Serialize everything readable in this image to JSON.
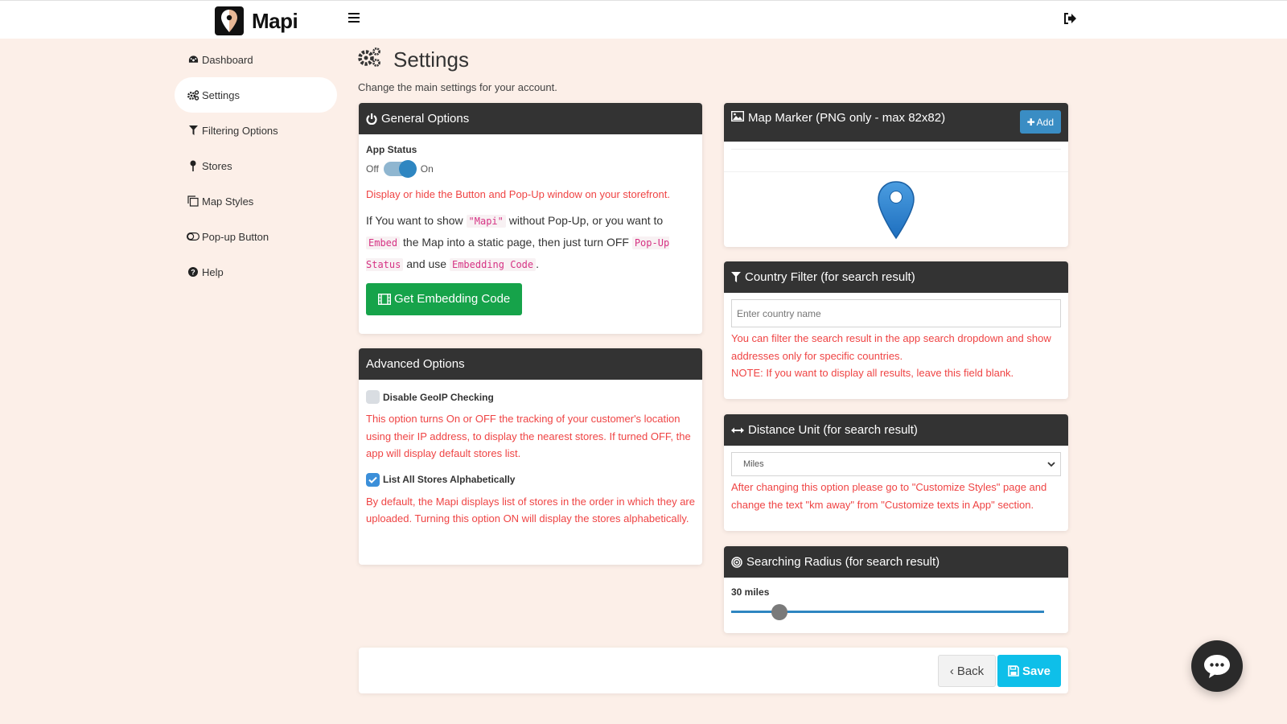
{
  "app": {
    "name": "Mapi"
  },
  "topbar": {
    "menu_icon": "hamburger-icon",
    "logout_icon": "sign-out-icon"
  },
  "sidebar": {
    "items": [
      {
        "label": "Dashboard",
        "icon": "dashboard-icon",
        "active": false
      },
      {
        "label": "Settings",
        "icon": "cogs-icon",
        "active": true
      },
      {
        "label": "Filtering Options",
        "icon": "filter-icon",
        "active": false
      },
      {
        "label": "Stores",
        "icon": "map-pin-icon",
        "active": false
      },
      {
        "label": "Map Styles",
        "icon": "copy-icon",
        "active": false
      },
      {
        "label": "Pop-up Button",
        "icon": "toggle-icon",
        "active": false
      },
      {
        "label": "Help",
        "icon": "question-circle-icon",
        "active": false
      }
    ]
  },
  "page": {
    "title": "Settings",
    "subtitle": "Change the main settings for your account."
  },
  "general": {
    "title": "General Options",
    "app_status_label": "App Status",
    "toggle_off": "Off",
    "toggle_on": "On",
    "toggle_state": "on",
    "hint": "Display or hide the Button and Pop-Up window on your storefront.",
    "info": {
      "t1": "If You want to show ",
      "c1": "\"Mapi\"",
      "t2": " without Pop-Up, or you want to ",
      "c2": "Embed",
      "t3": " the Map into a static page, then just turn OFF ",
      "c3": "Pop-Up Status",
      "t4": " and use ",
      "c4": "Embedding Code",
      "t5": "."
    },
    "embed_button": "Get Embedding Code"
  },
  "advanced": {
    "title": "Advanced Options",
    "options": [
      {
        "label": "Disable GeoIP Checking",
        "checked": false,
        "hint": "This option turns On or OFF the tracking of your customer's location using their IP address, to display the nearest stores. If turned OFF, the app will display default stores list."
      },
      {
        "label": "List All Stores Alphabetically",
        "checked": true,
        "hint": "By default, the Mapi displays list of stores in the order in which they are uploaded. Turning this option ON will display the stores alphabetically."
      }
    ]
  },
  "marker": {
    "title": "Map Marker (PNG only - max 82x82)",
    "add_button": "Add",
    "marker_color": "#2f86cf"
  },
  "country": {
    "title": "Country Filter (for search result)",
    "placeholder": "Enter country name",
    "value": "",
    "hint1": "You can filter the search result in the app search dropdown and show addresses only for specific countries.",
    "hint2": "NOTE: If you want to display all results, leave this field blank."
  },
  "distance": {
    "title": "Distance Unit (for search result)",
    "selected": "Miles",
    "hint": "After changing this option please go to \"Customize Styles\" page and change the text \"km away\" from \"Customize texts in App\" section."
  },
  "radius": {
    "title": "Searching Radius (for search result)",
    "value_label": "30 miles",
    "value": 30,
    "fraction": 0.155
  },
  "footer": {
    "back": "Back",
    "save": "Save"
  },
  "colors": {
    "accent": "#2e86c1",
    "save": "#0ebfe9",
    "green": "#16a34a",
    "danger": "#ef4444",
    "header": "#333333",
    "background": "#fcefe8"
  }
}
